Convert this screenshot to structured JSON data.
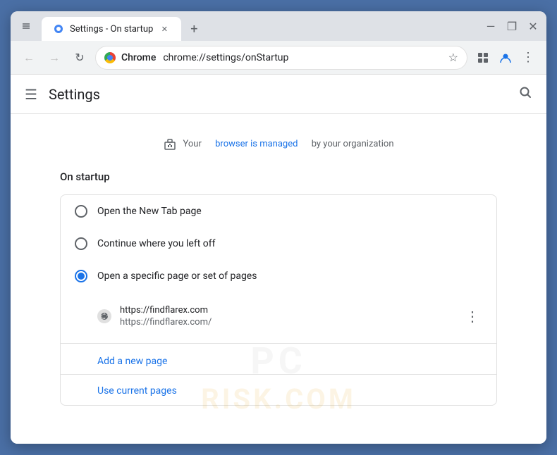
{
  "window": {
    "title": "Settings - On startup",
    "tab_label": "Settings - On startup",
    "new_tab_symbol": "+",
    "minimize_symbol": "—",
    "maximize_symbol": "❐",
    "close_symbol": "✕"
  },
  "toolbar": {
    "back_symbol": "←",
    "forward_symbol": "→",
    "reload_symbol": "↻",
    "chrome_label": "Chrome",
    "address": "chrome://settings/onStartup",
    "star_symbol": "☆",
    "extensions_symbol": "⊞",
    "profile_symbol": "👤",
    "menu_symbol": "⋮"
  },
  "header": {
    "menu_symbol": "☰",
    "title": "Settings",
    "search_symbol": "🔍"
  },
  "managed_banner": {
    "icon": "🏢",
    "text_before": "Your",
    "link_text": "browser is managed",
    "text_after": "by your organization"
  },
  "section": {
    "title": "On startup",
    "options": [
      {
        "id": "new-tab",
        "label": "Open the New Tab page",
        "selected": false
      },
      {
        "id": "continue",
        "label": "Continue where you left off",
        "selected": false
      },
      {
        "id": "specific-pages",
        "label": "Open a specific page or set of pages",
        "selected": true
      }
    ],
    "startup_url": {
      "line1": "https://findflarex.com",
      "line2": "https://findflarex.com/",
      "more_symbol": "⋮"
    },
    "add_page_link": "Add a new page",
    "use_current_link": "Use current pages"
  }
}
